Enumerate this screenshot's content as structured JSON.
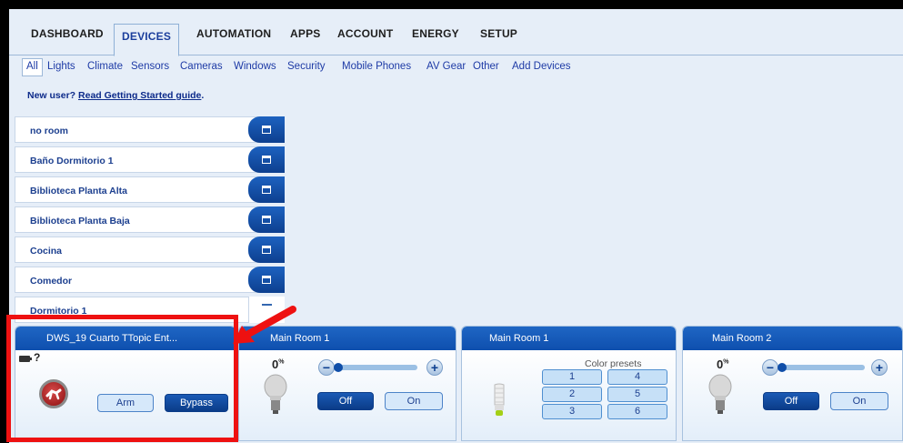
{
  "main_nav": {
    "tabs": [
      {
        "label": "DASHBOARD",
        "active": false
      },
      {
        "label": "DEVICES",
        "active": true
      },
      {
        "label": "AUTOMATION",
        "active": false
      },
      {
        "label": "APPS",
        "active": false
      },
      {
        "label": "ACCOUNT",
        "active": false
      },
      {
        "label": "ENERGY",
        "active": false
      },
      {
        "label": "SETUP",
        "active": false
      }
    ]
  },
  "sub_nav": {
    "items": [
      {
        "label": "All",
        "active": true
      },
      {
        "label": "Lights"
      },
      {
        "label": "Climate"
      },
      {
        "label": "Sensors"
      },
      {
        "label": "Cameras"
      },
      {
        "label": "Windows"
      },
      {
        "label": "Security"
      },
      {
        "label": "Mobile Phones"
      },
      {
        "label": "AV Gear"
      },
      {
        "label": "Other"
      },
      {
        "label": "Add Devices"
      }
    ]
  },
  "getting_started": {
    "prefix": "New user?",
    "link": "Read Getting Started guide",
    "suffix": "."
  },
  "rooms": [
    {
      "label": "no room",
      "expanded": false
    },
    {
      "label": "Baño Dormitorio 1",
      "expanded": false
    },
    {
      "label": "Biblioteca Planta Alta",
      "expanded": false
    },
    {
      "label": "Biblioteca Planta Baja",
      "expanded": false
    },
    {
      "label": "Cocina",
      "expanded": false
    },
    {
      "label": "Comedor",
      "expanded": false
    },
    {
      "label": "Dormitorio 1",
      "expanded": true
    }
  ],
  "devices": {
    "security": {
      "title": "DWS_19 Cuarto TTopic Ent...",
      "status_mark": "?",
      "arm_label": "Arm",
      "bypass_label": "Bypass",
      "icon": "motion-sensor-icon"
    },
    "dimmer1": {
      "title": "Main Room 1",
      "level_value": "0",
      "level_unit": "%",
      "off_label": "Off",
      "on_label": "On",
      "icon": "lightbulb-icon",
      "level_fraction": 0.0
    },
    "color": {
      "title": "Main Room 1",
      "presets_label": "Color presets",
      "presets": [
        "1",
        "4",
        "2",
        "5",
        "3",
        "6"
      ],
      "icon": "cfl-bulb-icon"
    },
    "dimmer2": {
      "title": "Main Room 2",
      "level_value": "0",
      "level_unit": "%",
      "off_label": "Off",
      "on_label": "On",
      "icon": "lightbulb-icon",
      "level_fraction": 0.0
    }
  },
  "annotation": {
    "color": "#ee1111"
  }
}
